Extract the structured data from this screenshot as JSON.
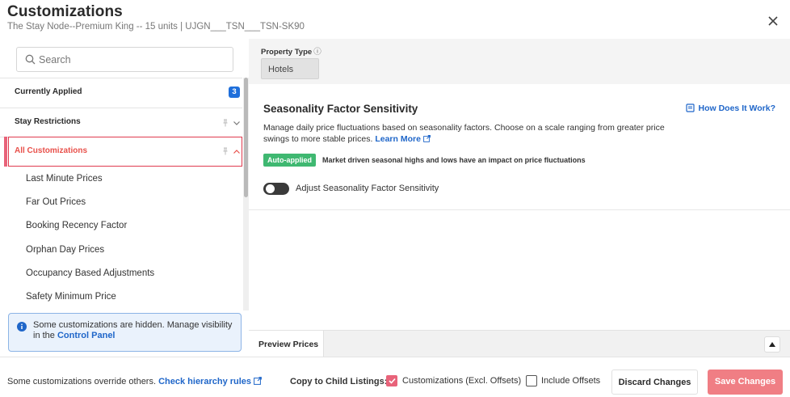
{
  "colors": {
    "accent": "#e8637a",
    "link": "#1f66c9",
    "badge": "#1f6fdb",
    "auto_applied": "#3fb871",
    "save_button": "#f07e84"
  },
  "header": {
    "title": "Customizations",
    "subtitle": "The Stay Node--Premium King -- 15 units | UJGN___TSN___TSN-SK90",
    "close_icon": "close-icon"
  },
  "sidebar": {
    "search_placeholder": "Search",
    "sections": {
      "currently_applied": {
        "label": "Currently Applied",
        "count": "3"
      },
      "stay_restrictions": {
        "label": "Stay Restrictions"
      },
      "all_customizations": {
        "label": "All Customizations"
      }
    },
    "items": [
      "Last Minute Prices",
      "Far Out Prices",
      "Booking Recency Factor",
      "Orphan Day Prices",
      "Occupancy Based Adjustments",
      "Safety Minimum Price"
    ],
    "info": {
      "text": "Some customizations are hidden. Manage visibility in the",
      "link": "Control Panel"
    }
  },
  "main": {
    "property_type": {
      "label": "Property Type",
      "info_glyph": "ⓘ",
      "value": "Hotels"
    },
    "card": {
      "title": "Seasonality Factor Sensitivity",
      "how_link": "How Does It Work?",
      "description": "Manage daily price fluctuations based on seasonality factors. Choose on a scale ranging from greater price swings to more stable prices.",
      "learn_more": "Learn More",
      "auto_badge": "Auto-applied",
      "auto_text": "Market driven seasonal highs and lows have an impact on price fluctuations",
      "toggle_label": "Adjust Seasonality Factor Sensitivity",
      "toggle_on": false
    },
    "preview_tab": "Preview Prices"
  },
  "footer": {
    "note": "Some customizations override others.",
    "hierarchy_link": "Check hierarchy rules",
    "copy_label": "Copy to Child Listings:",
    "opt1_label": "Customizations (Excl. Offsets)",
    "opt1_checked": true,
    "opt2_label": "Include Offsets",
    "opt2_checked": false,
    "discard": "Discard Changes",
    "save": "Save Changes"
  }
}
